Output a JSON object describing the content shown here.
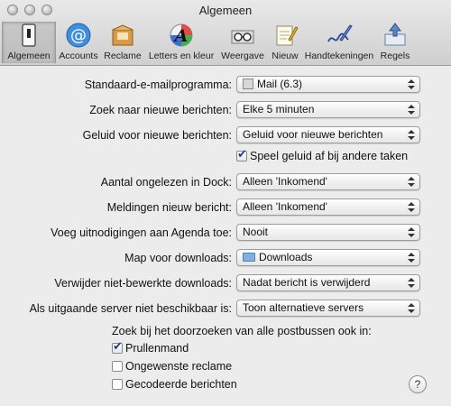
{
  "window": {
    "title": "Algemeen"
  },
  "toolbar": [
    {
      "label": "Algemeen",
      "icon": "general-switch-icon",
      "selected": true
    },
    {
      "label": "Accounts",
      "icon": "at-sign-icon"
    },
    {
      "label": "Reclame",
      "icon": "junk-mail-icon"
    },
    {
      "label": "Letters en kleur",
      "icon": "fonts-colors-icon"
    },
    {
      "label": "Weergave",
      "icon": "glasses-icon"
    },
    {
      "label": "Nieuw",
      "icon": "compose-icon"
    },
    {
      "label": "Handtekeningen",
      "icon": "signature-icon"
    },
    {
      "label": "Regels",
      "icon": "rules-icon"
    }
  ],
  "form": {
    "default_mail": {
      "label": "Standaard-e-mailprogramma:",
      "value": "Mail (6.3)"
    },
    "check_new": {
      "label": "Zoek naar nieuwe berichten:",
      "value": "Elke 5 minuten"
    },
    "new_sound": {
      "label": "Geluid voor nieuwe berichten:",
      "value": "Geluid voor nieuwe berichten"
    },
    "play_sound_other": {
      "label": "Speel geluid af bij andere taken",
      "checked": true
    },
    "dock_unread": {
      "label": "Aantal ongelezen in Dock:",
      "value": "Alleen 'Inkomend'"
    },
    "notifications": {
      "label": "Meldingen nieuw bericht:",
      "value": "Alleen 'Inkomend'"
    },
    "invitations": {
      "label": "Voeg uitnodigingen aan Agenda toe:",
      "value": "Nooit"
    },
    "downloads_folder": {
      "label": "Map voor downloads:",
      "value": "Downloads"
    },
    "remove_downloads": {
      "label": "Verwijder niet-bewerkte downloads:",
      "value": "Nadat bericht is verwijderd"
    },
    "outgoing_unavailable": {
      "label": "Als uitgaande server niet beschikbaar is:",
      "value": "Toon alternatieve servers"
    },
    "search_heading": "Zoek bij het doorzoeken van alle postbussen ook in:",
    "search_in": [
      {
        "label": "Prullenmand",
        "checked": true
      },
      {
        "label": "Ongewenste reclame",
        "checked": false
      },
      {
        "label": "Gecodeerde berichten",
        "checked": false
      }
    ]
  },
  "help": "?"
}
